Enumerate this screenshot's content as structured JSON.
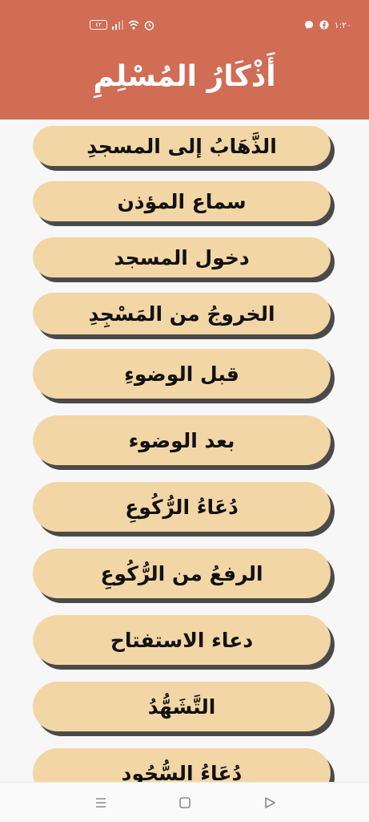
{
  "app": {
    "title": "أَذْكَارُ المُسْلِمِ"
  },
  "status_bar": {
    "time": "١:٢٠",
    "battery_level": "٤٢",
    "icons": [
      "battery-icon",
      "signal-icon",
      "wifi-icon",
      "alarm-icon",
      "facebook-icon",
      "messenger-icon"
    ]
  },
  "items": [
    {
      "label": "الذَّهَابُ إلى المسجدِ"
    },
    {
      "label": "سماع المؤذن"
    },
    {
      "label": "دخول المسجد"
    },
    {
      "label": "الخروجُ من المَسْجِدِ"
    },
    {
      "label": "قبل الوضوءِ"
    },
    {
      "label": "بعد الوضوء"
    },
    {
      "label": "دُعَاءُ الرُّكُوعِ"
    },
    {
      "label": "الرفعُ من الرُّكُوعِ"
    },
    {
      "label": "دعاء الاستفتاح"
    },
    {
      "label": "التَّشَهُّدُ"
    },
    {
      "label": "دُعَاءُ السُّجُودِ"
    }
  ],
  "colors": {
    "header": "#d16c55",
    "button_fill": "#f3d6a5",
    "button_shadow": "#4a4a4a",
    "background": "#f7f7f7"
  },
  "nav_bar": {
    "icons": [
      "menu-icon",
      "home-square-icon",
      "back-triangle-icon"
    ]
  }
}
